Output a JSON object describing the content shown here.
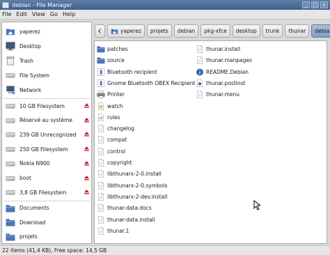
{
  "window": {
    "title": "debian - File Manager"
  },
  "menu": [
    "File",
    "Edit",
    "View",
    "Go",
    "Help"
  ],
  "sidebar": {
    "places": [
      {
        "label": "yaperez",
        "icon": "home-folder-icon"
      },
      {
        "label": "Desktop",
        "icon": "desktop-icon"
      },
      {
        "label": "Trash",
        "icon": "trash-icon"
      },
      {
        "label": "File System",
        "icon": "harddisk-icon"
      },
      {
        "label": "Network",
        "icon": "network-icon"
      }
    ],
    "devices": [
      {
        "label": "10 GB Filesystem",
        "icon": "drive-icon",
        "eject": true
      },
      {
        "label": "Réservé au système",
        "icon": "drive-icon",
        "eject": true
      },
      {
        "label": "239 GB Unrecognized",
        "icon": "drive-icon",
        "eject": true
      },
      {
        "label": "250 GB Filesystem",
        "icon": "drive-icon",
        "eject": true
      },
      {
        "label": "Nokia N900",
        "icon": "drive-icon",
        "eject": true
      },
      {
        "label": "boot",
        "icon": "drive-icon",
        "eject": true
      },
      {
        "label": "3,8 GB Filesystem",
        "icon": "drive-icon",
        "eject": true
      }
    ],
    "bookmarks": [
      {
        "label": "Documents",
        "icon": "folder-icon"
      },
      {
        "label": "Download",
        "icon": "folder-icon"
      },
      {
        "label": "projets",
        "icon": "folder-icon"
      }
    ]
  },
  "pathbar": {
    "back_icon": "chevron-left-icon",
    "crumbs": [
      "yaperez",
      "projets",
      "debian",
      "pkg-xfce",
      "desktop",
      "trunk",
      "thunar",
      "debian"
    ],
    "active_index": 7
  },
  "files": {
    "column1": [
      {
        "name": "patches",
        "type": "folder"
      },
      {
        "name": "source",
        "type": "folder"
      },
      {
        "name": "Bluetooth recipient",
        "type": "bluetooth"
      },
      {
        "name": "Gnome Bluetooth OBEX Recipient",
        "type": "bluetooth"
      },
      {
        "name": "Printer",
        "type": "printer"
      },
      {
        "name": "watch",
        "type": "watch"
      },
      {
        "name": "rules",
        "type": "script"
      },
      {
        "name": "changelog",
        "type": "text"
      },
      {
        "name": "compat",
        "type": "text"
      },
      {
        "name": "control",
        "type": "text"
      },
      {
        "name": "copyright",
        "type": "text"
      },
      {
        "name": "libthunarx-2-0.install",
        "type": "text"
      },
      {
        "name": "libthunarx-2-0.symbols",
        "type": "text"
      },
      {
        "name": "libthunarx-2-dev.install",
        "type": "text"
      },
      {
        "name": "thunar-data.docs",
        "type": "text"
      },
      {
        "name": "thunar-data.install",
        "type": "text"
      },
      {
        "name": "thunar.1",
        "type": "text"
      }
    ],
    "column2": [
      {
        "name": "thunar.install",
        "type": "text"
      },
      {
        "name": "thunar.manpages",
        "type": "text"
      },
      {
        "name": "README.Debian",
        "type": "readme"
      },
      {
        "name": "thunar.postinst",
        "type": "postinst"
      },
      {
        "name": "thunar.menu",
        "type": "text"
      }
    ]
  },
  "status": {
    "text": "22 items (41,4 KB), Free space: 14,5 GB"
  },
  "colors": {
    "selection": "#7e9cc2",
    "eject": "#c4161c",
    "folder": "#4a78b8"
  }
}
